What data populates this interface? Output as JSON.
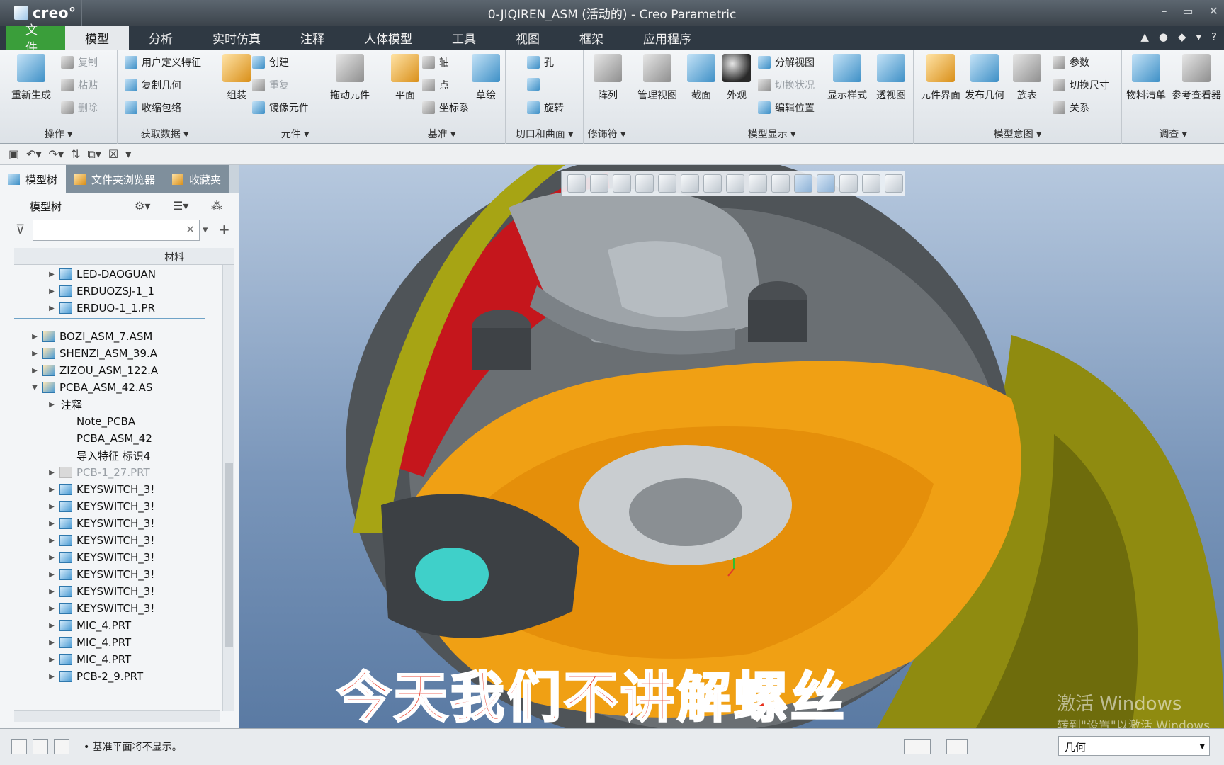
{
  "window": {
    "title": "0-JIQIREN_ASM (活动的) - Creo Parametric",
    "logo": "creo°"
  },
  "menu": {
    "tabs": [
      "文件",
      "模型",
      "分析",
      "实时仿真",
      "注释",
      "人体模型",
      "工具",
      "视图",
      "框架",
      "应用程序"
    ]
  },
  "ribbon": {
    "operations": {
      "regenerate": "重新生成",
      "copy": "复制",
      "paste": "粘贴",
      "delete": "删除",
      "label": "操作 ▾"
    },
    "get_data": {
      "udf": "用户定义特征",
      "copy_geom": "复制几何",
      "shrinkwrap": "收缩包络",
      "label": "获取数据 ▾"
    },
    "component": {
      "assemble": "组装",
      "create": "创建",
      "repeat": "重复",
      "mirror": "镜像元件",
      "drag": "拖动元件",
      "label": "元件 ▾"
    },
    "datum": {
      "plane": "平面",
      "axis": "轴",
      "point": "点",
      "csys": "坐标系",
      "sketch": "草绘",
      "label": "基准 ▾"
    },
    "cut_surface": {
      "hole": "孔",
      "revolve": "旋转",
      "label": "切口和曲面 ▾"
    },
    "modifiers": {
      "pattern": "阵列",
      "label": "修饰符 ▾"
    },
    "model_display": {
      "manage_views": "管理视图",
      "section": "截面",
      "appearance": "外观",
      "explode": "分解视图",
      "toggle_status": "切换状况",
      "edit_position": "编辑位置",
      "display_style": "显示样式",
      "perspective": "透视图",
      "label": "模型显示 ▾"
    },
    "model_intent": {
      "component_interface": "元件界面",
      "publish_geom": "发布几何",
      "family_table": "族表",
      "parameters": "参数",
      "switch_dims": "切换尺寸",
      "relations": "关系",
      "label": "模型意图 ▾"
    },
    "investigate": {
      "bom": "物料清单",
      "reference_viewer": "参考查看器",
      "label": "调查 ▾"
    }
  },
  "panel": {
    "tabs": [
      "模型树",
      "文件夹浏览器",
      "收藏夹"
    ],
    "tree_title": "模型树",
    "column_material": "材料",
    "items": [
      {
        "label": "LED-DAOGUAN",
        "level": 1,
        "type": "part",
        "expand": "▶"
      },
      {
        "label": "ERDUOZSJ-1_1",
        "level": 1,
        "type": "part",
        "expand": "▶"
      },
      {
        "label": "ERDUO-1_1.PR",
        "level": 1,
        "type": "part",
        "expand": "▶"
      },
      {
        "label": "BOZI_ASM_7.ASM",
        "level": 0,
        "type": "asm",
        "expand": "▶"
      },
      {
        "label": "SHENZI_ASM_39.A",
        "level": 0,
        "type": "asm",
        "expand": "▶"
      },
      {
        "label": "ZIZOU_ASM_122.A",
        "level": 0,
        "type": "asm",
        "expand": "▶"
      },
      {
        "label": "PCBA_ASM_42.AS",
        "level": 0,
        "type": "asm",
        "expand": "▼"
      },
      {
        "label": "注释",
        "level": 1,
        "type": "none",
        "expand": "▶"
      },
      {
        "label": "Note_PCBA",
        "level": 1,
        "type": "note",
        "expand": ""
      },
      {
        "label": "PCBA_ASM_42",
        "level": 1,
        "type": "note",
        "expand": ""
      },
      {
        "label": "导入特征 标识4",
        "level": 1,
        "type": "note",
        "expand": ""
      },
      {
        "label": "PCB-1_27.PRT",
        "level": 1,
        "type": "dim",
        "expand": "▶"
      },
      {
        "label": "KEYSWITCH_3!",
        "level": 1,
        "type": "part",
        "expand": "▶"
      },
      {
        "label": "KEYSWITCH_3!",
        "level": 1,
        "type": "part",
        "expand": "▶"
      },
      {
        "label": "KEYSWITCH_3!",
        "level": 1,
        "type": "part",
        "expand": "▶"
      },
      {
        "label": "KEYSWITCH_3!",
        "level": 1,
        "type": "part",
        "expand": "▶"
      },
      {
        "label": "KEYSWITCH_3!",
        "level": 1,
        "type": "part",
        "expand": "▶"
      },
      {
        "label": "KEYSWITCH_3!",
        "level": 1,
        "type": "part",
        "expand": "▶"
      },
      {
        "label": "KEYSWITCH_3!",
        "level": 1,
        "type": "part",
        "expand": "▶"
      },
      {
        "label": "KEYSWITCH_3!",
        "level": 1,
        "type": "part",
        "expand": "▶"
      },
      {
        "label": "MIC_4.PRT",
        "level": 1,
        "type": "part",
        "expand": "▶"
      },
      {
        "label": "MIC_4.PRT",
        "level": 1,
        "type": "part",
        "expand": "▶"
      },
      {
        "label": "MIC_4.PRT",
        "level": 1,
        "type": "part",
        "expand": "▶"
      },
      {
        "label": "PCB-2_9.PRT",
        "level": 1,
        "type": "part",
        "expand": "▶"
      }
    ]
  },
  "viewport": {
    "subtitle": "今天我们不讲解螺丝",
    "watermark_line1": "激活 Windows",
    "watermark_line2": "转到\"设置\"以激活 Windows"
  },
  "status": {
    "message": "• 基准平面将不显示。",
    "filter_value": "几何"
  },
  "colors": {
    "shell_orange": "#f0a014",
    "shell_dark": "#555a5e",
    "red_interior": "#c5161c",
    "olive": "#9c9a12",
    "teal_lens": "#3fd0c9"
  }
}
